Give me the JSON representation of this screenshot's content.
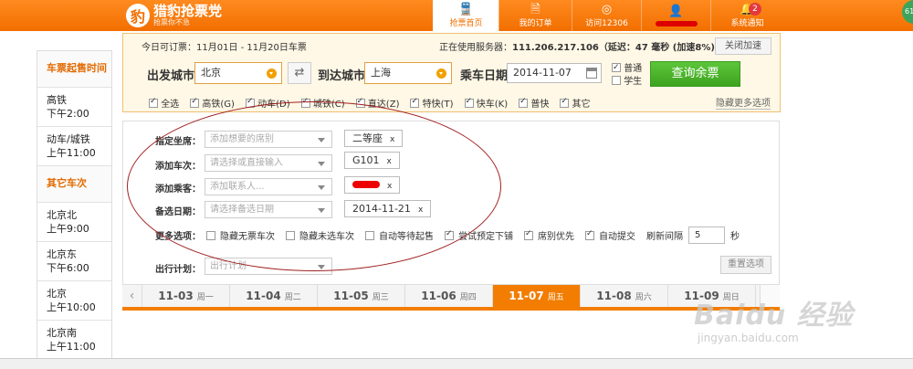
{
  "header": {
    "logo_glyph": "豹",
    "logo_title": "猎豹抢票党",
    "logo_sub": "抢票你不急",
    "nav": [
      {
        "icon": "🚆",
        "label": "抢票首页"
      },
      {
        "icon": "🗎",
        "label": "我的订单"
      },
      {
        "icon": "◎",
        "label": "访问12306"
      },
      {
        "icon": "👤",
        "label": ""
      },
      {
        "icon": "🔔",
        "label": "系统通知",
        "badge": "2"
      }
    ],
    "edge_badge": "61"
  },
  "sidebar": {
    "heading1": "车票起售时间",
    "items1": [
      {
        "line1": "高铁",
        "line2": "下午2:00"
      },
      {
        "line1": "动车/城铁",
        "line2": "上午11:00"
      }
    ],
    "heading2": "其它车次",
    "items2": [
      {
        "line1": "北京北",
        "line2": "上午9:00"
      },
      {
        "line1": "北京东",
        "line2": "下午6:00"
      },
      {
        "line1": "北京",
        "line2": "上午10:00"
      },
      {
        "line1": "北京南",
        "line2": "上午11:00"
      }
    ]
  },
  "search": {
    "bookable": "今日可订票：11月01日 - 11月20日车票",
    "server_prefix": "正在使用服务器：",
    "server_ip": "111.206.217.106",
    "latency": "（延迟：47 毫秒 (加速8%)）",
    "close_accel": "关闭加速",
    "from_label": "出发城市",
    "from_value": "北京",
    "to_label": "到达城市",
    "to_value": "上海",
    "date_label": "乘车日期",
    "date_value": "2014-11-07",
    "opt_normal": "普通",
    "opt_student": "学生",
    "query": "查询余票",
    "types": [
      "全选",
      "高铁(G)",
      "动车(D)",
      "城铁(C)",
      "直达(Z)",
      "特快(T)",
      "快车(K)",
      "普快",
      "其它"
    ],
    "more": "隐藏更多选项"
  },
  "filters": {
    "seat_label": "指定坐席：",
    "seat_placeholder": "添加想要的席别",
    "seat_tag": "二等座",
    "train_label": "添加车次：",
    "train_placeholder": "请选择或直接输入",
    "train_tag": "G101",
    "passenger_label": "添加乘客：",
    "passenger_placeholder": "添加联系人...",
    "backup_label": "备选日期：",
    "backup_placeholder": "请选择备选日期",
    "backup_tag": "2014-11-21",
    "more_label": "更多选项：",
    "options": [
      {
        "label": "隐藏无票车次",
        "checked": false
      },
      {
        "label": "隐藏未选车次",
        "checked": false
      },
      {
        "label": "自动等待起售",
        "checked": false
      },
      {
        "label": "尝试预定下铺",
        "checked": true
      },
      {
        "label": "席别优先",
        "checked": true
      },
      {
        "label": "自动提交",
        "checked": true
      }
    ],
    "interval_label": "刷新间隔",
    "interval_value": "5",
    "interval_unit": "秒",
    "plan_label": "出行计划：",
    "plan_placeholder": "出行计划",
    "reset": "重置选项",
    "remove_glyph": "x"
  },
  "datebar": {
    "prev": "‹",
    "dates": [
      {
        "date": "11-03",
        "weekday": "周一"
      },
      {
        "date": "11-04",
        "weekday": "周二"
      },
      {
        "date": "11-05",
        "weekday": "周三"
      },
      {
        "date": "11-06",
        "weekday": "周四"
      },
      {
        "date": "11-07",
        "weekday": "周五",
        "active": true
      },
      {
        "date": "11-08",
        "weekday": "周六"
      },
      {
        "date": "11-09",
        "weekday": "周日"
      }
    ]
  },
  "watermark": {
    "main": "Baidu 经验",
    "sub": "jingyan.baidu.com"
  },
  "colors": {
    "accent": "#f27d00",
    "query_green": "#3ea31f",
    "annotation_red": "#a02020"
  }
}
